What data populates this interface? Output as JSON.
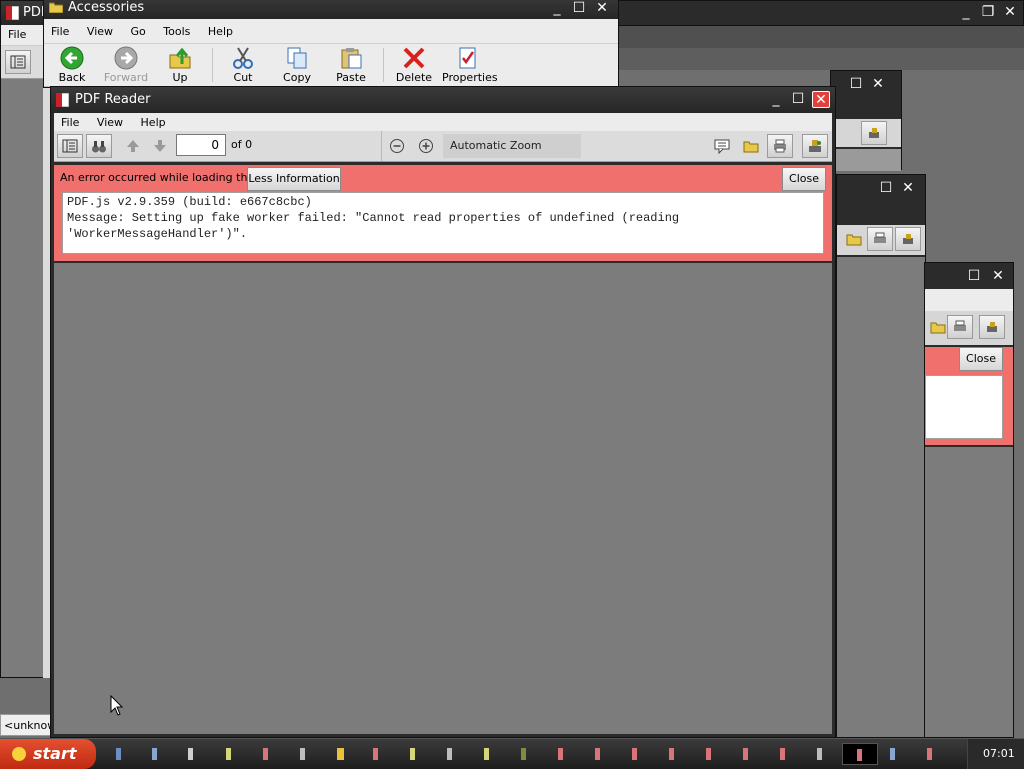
{
  "back_window": {
    "title": "PDF",
    "menu": [
      "File"
    ]
  },
  "background_bar": {
    "label": "<unknown"
  },
  "explorer": {
    "title": "Accessories",
    "menu": [
      "File",
      "View",
      "Go",
      "Tools",
      "Help"
    ],
    "toolbar": {
      "back": "Back",
      "forward": "Forward",
      "up": "Up",
      "cut": "Cut",
      "copy": "Copy",
      "paste": "Paste",
      "delete": "Delete",
      "properties": "Properties"
    }
  },
  "pdf_reader": {
    "title": "PDF Reader",
    "menu": [
      "File",
      "View",
      "Help"
    ],
    "page_number": "0",
    "page_count": "of 0",
    "zoom": "Automatic Zoom",
    "error": {
      "summary": "An error occurred while loading the PDF.",
      "less_info_label": "Less Information",
      "close_label": "Close",
      "details": "PDF.js v2.9.359 (build: e667c8cbc)\nMessage: Setting up fake worker failed: \"Cannot read properties of undefined (reading\n'WorkerMessageHandler')\"."
    }
  },
  "stacked_window": {
    "close_label": "Close"
  },
  "taskbar": {
    "start_label": "start",
    "clock": "07:01"
  },
  "colors": {
    "error_bg": "#f0706e",
    "close_red": "#e2413b",
    "start_red": "#d23a1d"
  }
}
